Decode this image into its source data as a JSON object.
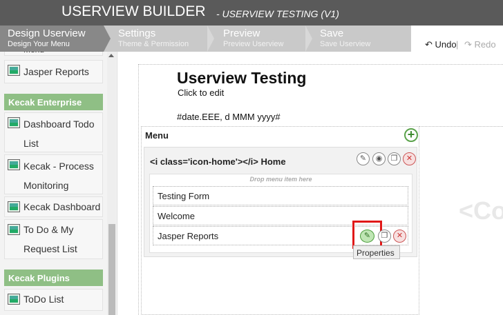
{
  "header": {
    "title": "USERVIEW BUILDER",
    "subtitle": "- USERVIEW TESTING (V1)"
  },
  "steps": [
    {
      "label": "Design Userview",
      "sub": "Design Your Menu"
    },
    {
      "label": "Settings",
      "sub": "Theme & Permission"
    },
    {
      "label": "Preview",
      "sub": "Preview Userview"
    },
    {
      "label": "Save",
      "sub": "Save Userview"
    }
  ],
  "toolbar": {
    "undo": "Undo",
    "separator": "|",
    "redo": "Redo"
  },
  "sidebar": {
    "partial_item": "Menu",
    "items_top": [
      "Jasper Reports"
    ],
    "header_enterprise": "Kecak Enterprise",
    "enterprise_items": [
      "Dashboard Todo List",
      "Kecak - Process Monitoring",
      "Kecak Dashboard",
      "To Do & My Request List"
    ],
    "header_plugins": "Kecak Plugins",
    "plugin_items": [
      "ToDo List"
    ]
  },
  "canvas": {
    "title": "Userview Testing",
    "click_to_edit": "Click to edit",
    "date_format": "#date.EEE, d MMM yyyy#",
    "ghost_text": "<Co"
  },
  "menu": {
    "label": "Menu",
    "category": "<i class='icon-home'></i> Home",
    "drop_hint": "Drop menu item here",
    "items": [
      "Testing Form",
      "Welcome",
      "Jasper Reports"
    ],
    "tooltip": "Properties"
  }
}
